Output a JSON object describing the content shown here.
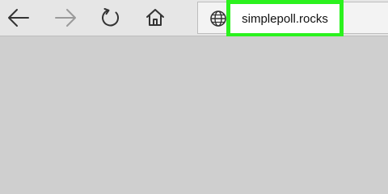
{
  "toolbar": {
    "buttons": [
      {
        "name": "back",
        "icon": "back-arrow-icon",
        "enabled": true
      },
      {
        "name": "forward",
        "icon": "forward-arrow-icon",
        "enabled": false
      },
      {
        "name": "refresh",
        "icon": "refresh-icon",
        "enabled": true
      },
      {
        "name": "home",
        "icon": "home-icon",
        "enabled": true
      }
    ]
  },
  "address_bar": {
    "icon": "globe-icon",
    "url": "simplepoll.rocks",
    "highlight_color": "#2bf21e"
  },
  "colors": {
    "toolbar_bg": "#e6e6e6",
    "content_bg": "#cfcfcf",
    "icon_enabled": "#333333",
    "icon_disabled": "#9a9a9a"
  }
}
